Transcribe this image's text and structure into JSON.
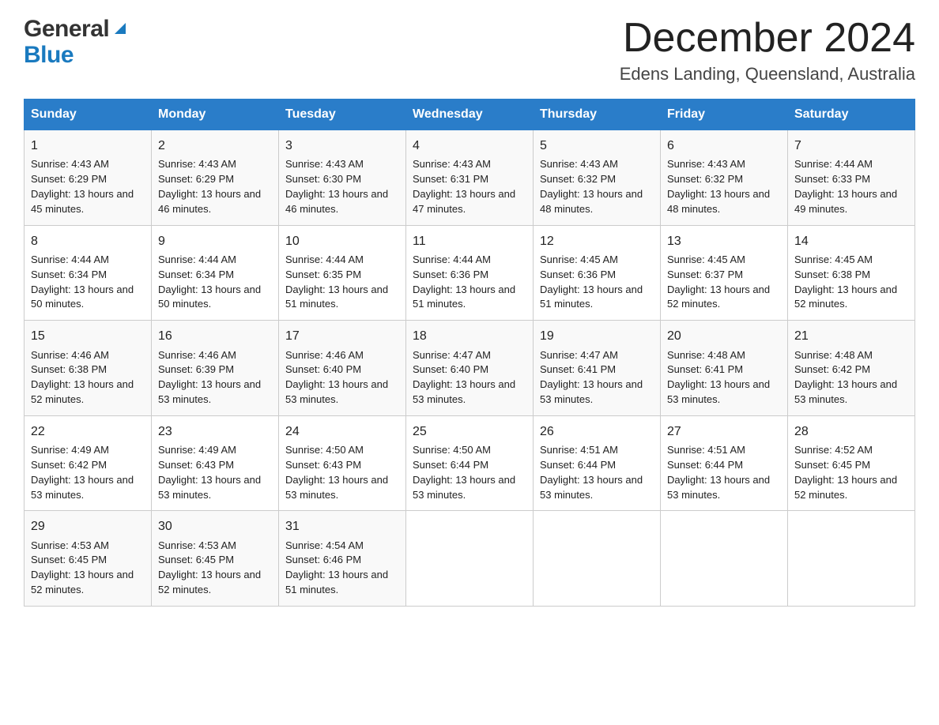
{
  "header": {
    "logo_general": "General",
    "logo_blue": "Blue",
    "month_title": "December 2024",
    "location": "Edens Landing, Queensland, Australia"
  },
  "weekdays": [
    "Sunday",
    "Monday",
    "Tuesday",
    "Wednesday",
    "Thursday",
    "Friday",
    "Saturday"
  ],
  "weeks": [
    [
      {
        "day": "1",
        "sunrise": "4:43 AM",
        "sunset": "6:29 PM",
        "daylight": "13 hours and 45 minutes."
      },
      {
        "day": "2",
        "sunrise": "4:43 AM",
        "sunset": "6:29 PM",
        "daylight": "13 hours and 46 minutes."
      },
      {
        "day": "3",
        "sunrise": "4:43 AM",
        "sunset": "6:30 PM",
        "daylight": "13 hours and 46 minutes."
      },
      {
        "day": "4",
        "sunrise": "4:43 AM",
        "sunset": "6:31 PM",
        "daylight": "13 hours and 47 minutes."
      },
      {
        "day": "5",
        "sunrise": "4:43 AM",
        "sunset": "6:32 PM",
        "daylight": "13 hours and 48 minutes."
      },
      {
        "day": "6",
        "sunrise": "4:43 AM",
        "sunset": "6:32 PM",
        "daylight": "13 hours and 48 minutes."
      },
      {
        "day": "7",
        "sunrise": "4:44 AM",
        "sunset": "6:33 PM",
        "daylight": "13 hours and 49 minutes."
      }
    ],
    [
      {
        "day": "8",
        "sunrise": "4:44 AM",
        "sunset": "6:34 PM",
        "daylight": "13 hours and 50 minutes."
      },
      {
        "day": "9",
        "sunrise": "4:44 AM",
        "sunset": "6:34 PM",
        "daylight": "13 hours and 50 minutes."
      },
      {
        "day": "10",
        "sunrise": "4:44 AM",
        "sunset": "6:35 PM",
        "daylight": "13 hours and 51 minutes."
      },
      {
        "day": "11",
        "sunrise": "4:44 AM",
        "sunset": "6:36 PM",
        "daylight": "13 hours and 51 minutes."
      },
      {
        "day": "12",
        "sunrise": "4:45 AM",
        "sunset": "6:36 PM",
        "daylight": "13 hours and 51 minutes."
      },
      {
        "day": "13",
        "sunrise": "4:45 AM",
        "sunset": "6:37 PM",
        "daylight": "13 hours and 52 minutes."
      },
      {
        "day": "14",
        "sunrise": "4:45 AM",
        "sunset": "6:38 PM",
        "daylight": "13 hours and 52 minutes."
      }
    ],
    [
      {
        "day": "15",
        "sunrise": "4:46 AM",
        "sunset": "6:38 PM",
        "daylight": "13 hours and 52 minutes."
      },
      {
        "day": "16",
        "sunrise": "4:46 AM",
        "sunset": "6:39 PM",
        "daylight": "13 hours and 53 minutes."
      },
      {
        "day": "17",
        "sunrise": "4:46 AM",
        "sunset": "6:40 PM",
        "daylight": "13 hours and 53 minutes."
      },
      {
        "day": "18",
        "sunrise": "4:47 AM",
        "sunset": "6:40 PM",
        "daylight": "13 hours and 53 minutes."
      },
      {
        "day": "19",
        "sunrise": "4:47 AM",
        "sunset": "6:41 PM",
        "daylight": "13 hours and 53 minutes."
      },
      {
        "day": "20",
        "sunrise": "4:48 AM",
        "sunset": "6:41 PM",
        "daylight": "13 hours and 53 minutes."
      },
      {
        "day": "21",
        "sunrise": "4:48 AM",
        "sunset": "6:42 PM",
        "daylight": "13 hours and 53 minutes."
      }
    ],
    [
      {
        "day": "22",
        "sunrise": "4:49 AM",
        "sunset": "6:42 PM",
        "daylight": "13 hours and 53 minutes."
      },
      {
        "day": "23",
        "sunrise": "4:49 AM",
        "sunset": "6:43 PM",
        "daylight": "13 hours and 53 minutes."
      },
      {
        "day": "24",
        "sunrise": "4:50 AM",
        "sunset": "6:43 PM",
        "daylight": "13 hours and 53 minutes."
      },
      {
        "day": "25",
        "sunrise": "4:50 AM",
        "sunset": "6:44 PM",
        "daylight": "13 hours and 53 minutes."
      },
      {
        "day": "26",
        "sunrise": "4:51 AM",
        "sunset": "6:44 PM",
        "daylight": "13 hours and 53 minutes."
      },
      {
        "day": "27",
        "sunrise": "4:51 AM",
        "sunset": "6:44 PM",
        "daylight": "13 hours and 53 minutes."
      },
      {
        "day": "28",
        "sunrise": "4:52 AM",
        "sunset": "6:45 PM",
        "daylight": "13 hours and 52 minutes."
      }
    ],
    [
      {
        "day": "29",
        "sunrise": "4:53 AM",
        "sunset": "6:45 PM",
        "daylight": "13 hours and 52 minutes."
      },
      {
        "day": "30",
        "sunrise": "4:53 AM",
        "sunset": "6:45 PM",
        "daylight": "13 hours and 52 minutes."
      },
      {
        "day": "31",
        "sunrise": "4:54 AM",
        "sunset": "6:46 PM",
        "daylight": "13 hours and 51 minutes."
      },
      null,
      null,
      null,
      null
    ]
  ],
  "labels": {
    "sunrise": "Sunrise:",
    "sunset": "Sunset:",
    "daylight": "Daylight:"
  }
}
